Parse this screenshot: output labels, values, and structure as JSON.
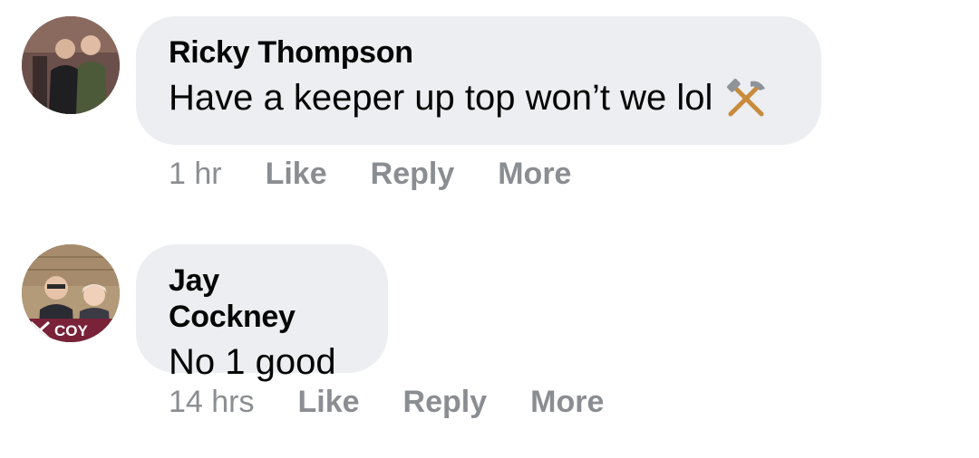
{
  "comments": [
    {
      "author": "Ricky Thompson",
      "text": "Have a keeper up top won’t we lol",
      "emoji_icon": "hammer-and-pick-icon",
      "time": "1 hr",
      "like_label": "Like",
      "reply_label": "Reply",
      "more_label": "More"
    },
    {
      "author": "Jay Cockney",
      "text": "No 1 good",
      "avatar_overlay_text": "COY",
      "time": "14 hrs",
      "like_label": "Like",
      "reply_label": "Reply",
      "more_label": "More"
    }
  ],
  "colors": {
    "bubble_bg": "#eceef1",
    "text": "#050505",
    "meta": "#8a8d91"
  }
}
